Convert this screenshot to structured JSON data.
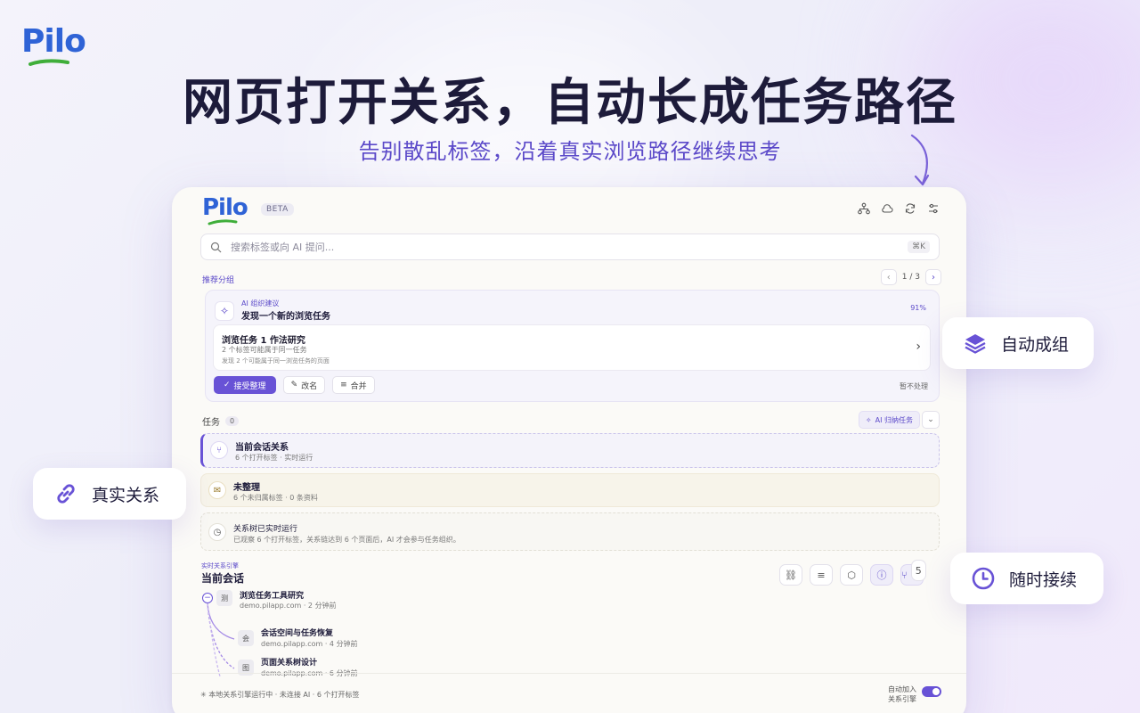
{
  "brand": {
    "logo_text": "Pilo"
  },
  "hero": {
    "headline": "网页打开关系，自动长成任务路径",
    "subhead": "告别散乱标签，沿着真实浏览路径继续思考"
  },
  "panel": {
    "logo_text": "Pilo",
    "beta_label": "BETA",
    "header_icons": [
      "tree-icon",
      "cloud-icon",
      "sync-icon",
      "settings-icon"
    ],
    "search": {
      "placeholder": "搜索标签或向 AI 提问...",
      "shortcut": "⌘K"
    },
    "recommended": {
      "label": "推荐分组",
      "page": "1 / 3",
      "card": {
        "kicker": "AI 组织建议",
        "title": "发现一个新的浏览任务",
        "confidence": "91%",
        "inner_title": "浏览任务 1 作法研究",
        "inner_line1": "2 个标签可能属于同一任务",
        "inner_line2": "发现 2 个可能属于同一浏览任务的页面",
        "accept": "接受整理",
        "rename": "改名",
        "merge": "合并",
        "skip": "暂不处理"
      }
    },
    "tasks": {
      "label": "任务",
      "count": "0",
      "ai_button": "AI 归纳任务",
      "rows": [
        {
          "title": "当前会话关系",
          "sub": "6 个打开标签 · 实时运行"
        },
        {
          "title": "未整理",
          "sub": "6 个未归属标签 · 0 条资料"
        },
        {
          "title": "关系树已实时运行",
          "sub": "已观察 6 个打开标签，关系链达到 6 个页面后，AI 才会参与任务组织。"
        }
      ]
    },
    "engine": {
      "label": "实时关系引擎",
      "title": "当前会话",
      "badge": "5",
      "nodes": [
        {
          "icon": "测",
          "title": "浏览任务工具研究",
          "sub": "demo.pilapp.com · 2 分钟前"
        },
        {
          "icon": "会",
          "title": "会话空间与任务恢复",
          "sub": "demo.pilapp.com · 4 分钟前"
        },
        {
          "icon": "图",
          "title": "页面关系树设计",
          "sub": "demo.pilapp.com · 6 分钟前"
        }
      ]
    },
    "footer": {
      "status": "本地关系引擎运行中 · 未连接 AI · 6 个打开标签",
      "toggle_line1": "自动加入",
      "toggle_line2": "关系引擎"
    }
  },
  "callouts": {
    "auto_group": "自动成组",
    "real_relations": "真实关系",
    "resume": "随时接续"
  },
  "colors": {
    "accent": "#6852d6",
    "logo_blue": "#2f63d6",
    "logo_green": "#3fae3a"
  }
}
